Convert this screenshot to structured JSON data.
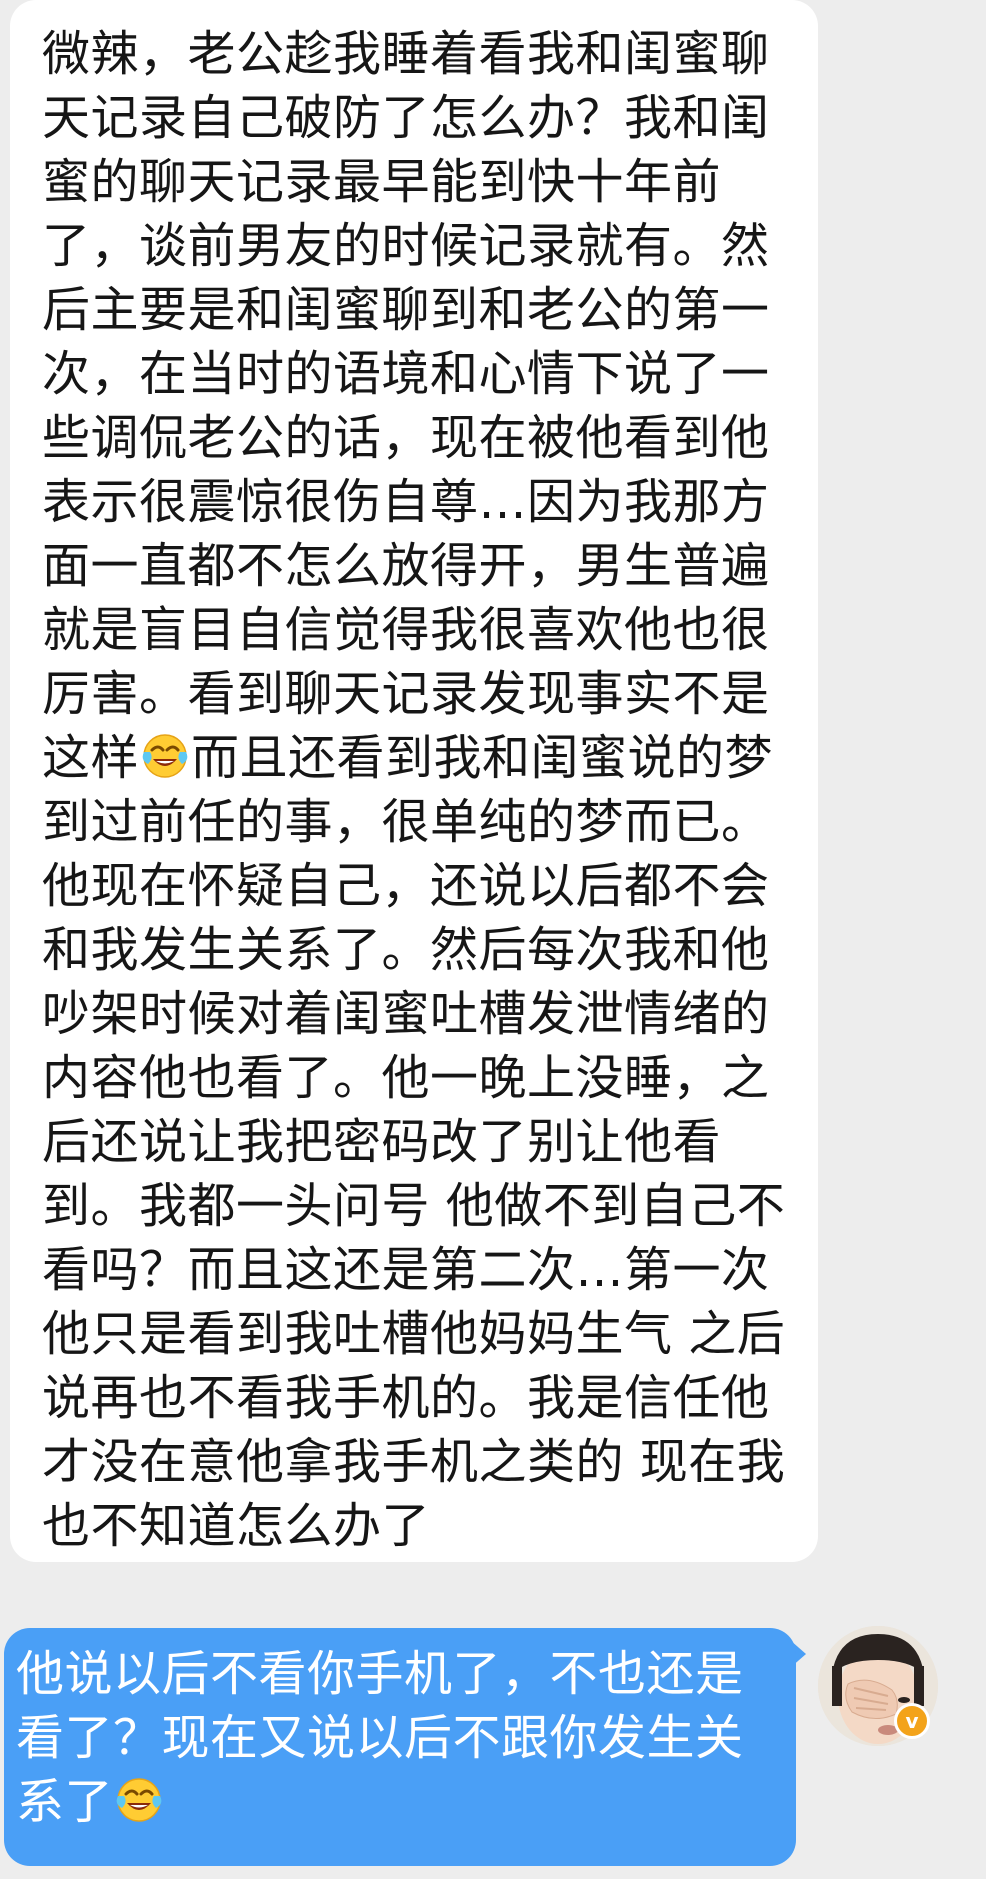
{
  "conversation": {
    "incoming": {
      "lines": [
        "微辣，老公趁我睡着看我和闺蜜聊",
        "天记录自己破防了怎么办？我和闺",
        "蜜的聊天记录最早能到快十年前",
        "了，谈前男友的时候记录就有。然",
        "后主要是和闺蜜聊到和老公的第一",
        "次，在当时的语境和心情下说了一",
        "些调侃老公的话，现在被他看到他",
        "表示很震惊很伤自尊…因为我那方",
        "面一直都不怎么放得开，男生普遍",
        "就是盲目自信觉得我很喜欢他也很",
        "厉害。看到聊天记录发现事实不是",
        "这样",
        "而且还看到我和闺蜜说的梦",
        "到过前任的事，很单纯的梦而已。",
        "他现在怀疑自己，还说以后都不会",
        "和我发生关系了。然后每次我和他",
        "吵架时候对着闺蜜吐槽发泄情绪的",
        "内容他也看了。他一晚上没睡，之",
        "后还说让我把密码改了别让他看",
        "到。我都一头问号 他做不到自己不",
        "看吗？而且这还是第二次…第一次",
        "他只是看到我吐槽他妈妈生气 之后",
        "说再也不看我手机的。我是信任他",
        "才没在意他拿我手机之类的 现在我",
        "也不知道怎么办了"
      ],
      "emoji": "laugh-cry-emoji"
    },
    "outgoing": {
      "lines": [
        "他说以后不看你手机了，不也还是",
        "看了？现在又说以后不跟你发生关",
        "系了"
      ],
      "emoji": "laugh-cry-emoji",
      "bubble_color": "#4a9ff6"
    },
    "avatar": {
      "badge_text": "v",
      "badge_color": "#f3a31a"
    }
  }
}
